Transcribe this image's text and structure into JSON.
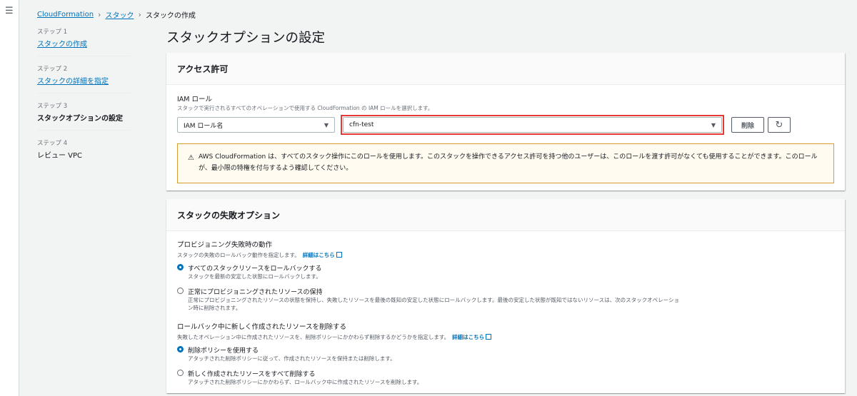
{
  "nav": {
    "menu_icon": "menu-icon"
  },
  "breadcrumb": {
    "items": [
      "CloudFormation",
      "スタック",
      "スタックの作成"
    ]
  },
  "steps": [
    {
      "num": "ステップ 1",
      "label": "スタックの作成"
    },
    {
      "num": "ステップ 2",
      "label": "スタックの詳細を指定"
    },
    {
      "num": "ステップ 3",
      "label": "スタックオプションの設定"
    },
    {
      "num": "ステップ 4",
      "label": "レビュー VPC"
    }
  ],
  "page_title": "スタックオプションの設定",
  "access": {
    "header": "アクセス許可",
    "iam_label": "IAM ロール",
    "iam_desc": "スタックで実行されるすべてのオペレーションで使用する CloudFormation の IAM ロールを選択します。",
    "type_select": "IAM ロール名",
    "role_select": "cfn-test",
    "delete_button": "削除",
    "warning": "AWS CloudFormation は、すべてのスタック操作にこのロールを使用します。このスタックを操作できるアクセス許可を持つ他のユーザーは、このロールを渡す許可がなくても使用することができます。このロールが、最小限の特権を付与するよう確認してください。"
  },
  "failure": {
    "header": "スタックの失敗オプション",
    "prov_label": "プロビジョニング失敗時の動作",
    "prov_desc": "スタックの失敗のロールバック動作を指定します。",
    "learn_more": "詳細はこちら",
    "opt1_label": "すべてのスタックリソースをロールバックする",
    "opt1_desc": "スタックを最新の安定した状態にロールバックします。",
    "opt2_label": "正常にプロビジョニングされたリソースの保持",
    "opt2_desc": "正常にプロビジョニングされたリソースの状態を保持し、失敗したリソースを最後の既知の安定した状態にロールバックします。最後の安定した状態が既知ではないリソースは、次のスタックオペレーション時に削除されます。",
    "del_label": "ロールバック中に新しく作成されたリソースを削除する",
    "del_desc": "失敗したオペレーション中に作成されたリソースを、削除ポリシーにかかわらず削除するかどうかを指定します。",
    "opt3_label": "削除ポリシーを使用する",
    "opt3_desc": "アタッチされた削除ポリシーに従って、作成されたリソースを保持または削除します。",
    "opt4_label": "新しく作成されたリソースをすべて削除する",
    "opt4_desc": "アタッチされた削除ポリシーにかかわらず、ロールバック中に作成されたリソースを削除します。"
  }
}
